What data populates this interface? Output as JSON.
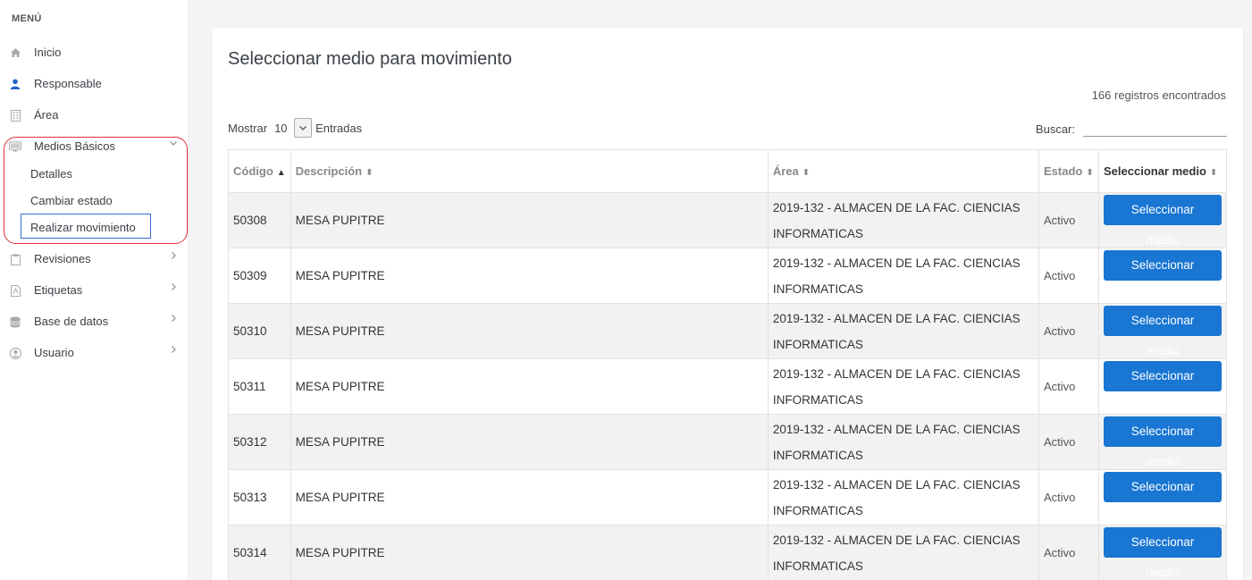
{
  "sidebar": {
    "title": "MENÚ",
    "items": [
      {
        "label": "Inicio",
        "icon": "home-icon"
      },
      {
        "label": "Responsable",
        "icon": "user-icon"
      },
      {
        "label": "Área",
        "icon": "building-icon"
      },
      {
        "label": "Medios Básicos",
        "icon": "monitor-icon"
      },
      {
        "label": "Revisiones",
        "icon": "clipboard-icon"
      },
      {
        "label": "Etiquetas",
        "icon": "file-pdf-icon"
      },
      {
        "label": "Base de datos",
        "icon": "database-icon"
      },
      {
        "label": "Usuario",
        "icon": "user-circle-icon"
      }
    ],
    "submenu": [
      "Detalles",
      "Cambiar estado",
      "Realizar movimiento"
    ]
  },
  "main": {
    "title": "Seleccionar medio para movimiento",
    "records": "166 registros encontrados",
    "show_label": "Mostrar",
    "show_value": "10",
    "entries_label": "Entradas",
    "search_label": "Buscar:",
    "search_value": "",
    "columns": [
      "Código",
      "Descripción",
      "Área",
      "Estado",
      "Seleccionar medio"
    ],
    "rows": [
      {
        "codigo": "50308",
        "descripcion": "MESA PUPITRE",
        "area_1": "2019-132 - ALMACEN DE LA FAC. CIENCIAS",
        "area_2": "INFORMATICAS",
        "estado": "Activo",
        "action": "Seleccionar medio"
      },
      {
        "codigo": "50309",
        "descripcion": "MESA PUPITRE",
        "area_1": "2019-132 - ALMACEN DE LA FAC. CIENCIAS",
        "area_2": "INFORMATICAS",
        "estado": "Activo",
        "action": "Seleccionar medio"
      },
      {
        "codigo": "50310",
        "descripcion": "MESA PUPITRE",
        "area_1": "2019-132 - ALMACEN DE LA FAC. CIENCIAS",
        "area_2": "INFORMATICAS",
        "estado": "Activo",
        "action": "Seleccionar medio"
      },
      {
        "codigo": "50311",
        "descripcion": "MESA PUPITRE",
        "area_1": "2019-132 - ALMACEN DE LA FAC. CIENCIAS",
        "area_2": "INFORMATICAS",
        "estado": "Activo",
        "action": "Seleccionar medio"
      },
      {
        "codigo": "50312",
        "descripcion": "MESA PUPITRE",
        "area_1": "2019-132 - ALMACEN DE LA FAC. CIENCIAS",
        "area_2": "INFORMATICAS",
        "estado": "Activo",
        "action": "Seleccionar medio"
      },
      {
        "codigo": "50313",
        "descripcion": "MESA PUPITRE",
        "area_1": "2019-132 - ALMACEN DE LA FAC. CIENCIAS",
        "area_2": "INFORMATICAS",
        "estado": "Activo",
        "action": "Seleccionar medio"
      },
      {
        "codigo": "50314",
        "descripcion": "MESA PUPITRE",
        "area_1": "2019-132 - ALMACEN DE LA FAC. CIENCIAS",
        "area_2": "INFORMATICAS",
        "estado": "Activo",
        "action": "Seleccionar medio"
      }
    ]
  },
  "colors": {
    "accent": "#1976d2",
    "highlight_outline": "#e0303a",
    "active_outline": "#3a6ccf"
  }
}
